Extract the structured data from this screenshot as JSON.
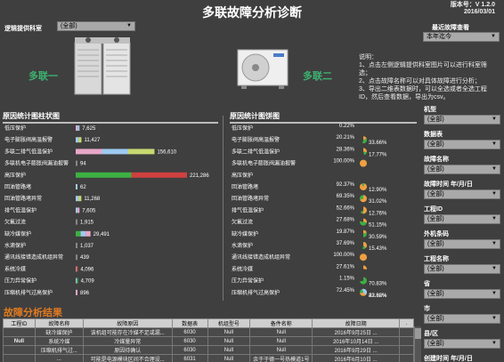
{
  "header": {
    "title": "多联故障分析诊断",
    "version": "版本号：V 1.2.0",
    "date": "2016/03/01"
  },
  "left_filter": {
    "label": "逻辑提供科室",
    "value": "(全部)"
  },
  "units": {
    "unit1": "多联一",
    "unit2": "多联二"
  },
  "instructions": {
    "heading": "说明：",
    "lines": [
      "1、点击左侧逻辑提供科室图片可以进行科室筛选；",
      "2、点击故障名称可以对具体故障进行分析；",
      "3、导出二维表数据时，可以全选或者全选工程ID，然后查看数据，导出为csv。"
    ]
  },
  "latest_fault": {
    "label": "最近故障查看",
    "value": "本年迄今"
  },
  "bar_chart_title": "原因统计图柱状图",
  "pie_chart_title": "原因统计图饼图",
  "chart_data": {
    "type": "bar",
    "orientation": "horizontal",
    "categories": [
      "低压保护",
      "电子膨胀阀高温报警",
      "多联二排气低温保护",
      "多联机电子膨胀阀漏油报警",
      "高压保护",
      "回油管路堵",
      "回油管路堵异常",
      "排气低温保护",
      "欠氟过流",
      "缺冷媒保护",
      "水滴保护",
      "通讯线接错造成机组异常",
      "系统冷媒",
      "压力异常保护",
      "压缩机排气过高保护"
    ],
    "values": [
      7625,
      11427,
      156610,
      94,
      221286,
      62,
      11268,
      7605,
      1915,
      29491,
      1037,
      439,
      4096,
      4709,
      896
    ],
    "labels": [
      "7,625",
      "11,427",
      "156,610",
      "94",
      "221,286",
      "62",
      "11,268",
      "7,605",
      "1,915",
      "29,491",
      "1,037",
      "439",
      "4,096",
      "4,709",
      "896"
    ],
    "xlim": [
      0,
      221286
    ],
    "pies": [
      {
        "category": "低压保护",
        "values": [
          0.22
        ],
        "labels": [
          "0.22%"
        ]
      },
      {
        "category": "电子膨胀阀高温报警",
        "values": [
          20.21,
          33.66
        ],
        "labels": [
          "20.21%",
          "33.66%"
        ]
      },
      {
        "category": "多联二排气低温保护",
        "values": [
          28.36,
          17.77
        ],
        "labels": [
          "28.36%",
          "17.77%"
        ]
      },
      {
        "category": "多联机电子膨胀阀漏油报警",
        "values": [
          100.0
        ],
        "labels": [
          "100.00%"
        ]
      },
      {
        "category": "高压保护",
        "values": [],
        "labels": []
      },
      {
        "category": "回油管路堵",
        "values": [
          92.37,
          12.9
        ],
        "labels": [
          "92.37%",
          "12.90%"
        ]
      },
      {
        "category": "回油管路堵异常",
        "values": [
          69.35,
          31.02
        ],
        "labels": [
          "69.35%",
          "31.02%"
        ]
      },
      {
        "category": "排气低温保护",
        "values": [
          52.66,
          12.76
        ],
        "labels": [
          "52.66%",
          "12.76%"
        ]
      },
      {
        "category": "欠氟过流",
        "values": [
          27.68,
          51.15
        ],
        "labels": [
          "27.68%",
          "51.15%"
        ]
      },
      {
        "category": "缺冷媒保护",
        "values": [
          19.87,
          30.59
        ],
        "labels": [
          "19.87%",
          "30.59%"
        ]
      },
      {
        "category": "水滴保护",
        "values": [
          37.69,
          15.43
        ],
        "labels": [
          "37.69%",
          "15.43%"
        ]
      },
      {
        "category": "通讯线接错造成机组异常",
        "values": [
          100.0
        ],
        "labels": [
          "100.00%"
        ]
      },
      {
        "category": "系统冷媒",
        "values": [
          27.61
        ],
        "labels": [
          "27.61%"
        ]
      },
      {
        "category": "压力异常保护",
        "values": [
          1.15,
          70.83
        ],
        "labels": [
          "1.15%",
          "70.83%"
        ]
      },
      {
        "category": "压缩机排气过高保护",
        "values": [
          72.45,
          22.32,
          43.68
        ],
        "labels": [
          "72.45%",
          "22.32%",
          "43.68%"
        ]
      }
    ]
  },
  "bar_segments": [
    [
      "#e8a8c8",
      "#9ec9f0"
    ],
    [
      "#9ec9f0",
      "#c8d870"
    ],
    [
      "#e8a8c8",
      "#9ec9f0",
      "#c8d870"
    ],
    [
      "#888888"
    ],
    [
      "#3cb043",
      "#d04040"
    ],
    [
      "#9ec9f0"
    ],
    [
      "#9ec9f0",
      "#c8d870"
    ],
    [
      "#9ec9f0",
      "#e8a8c8"
    ],
    [
      "#888888"
    ],
    [
      "#3cb043",
      "#9ec9f0",
      "#e8a8c8"
    ],
    [
      "#888888"
    ],
    [
      "#888888"
    ],
    [
      "#e08080",
      "#c06060"
    ],
    [
      "#9ec9f0",
      "#3cb043"
    ],
    [
      "#e8a8c8"
    ]
  ],
  "pie_colors": [
    "#f0a040",
    "#3cb043",
    "#9ec9f0",
    "#e8a8c8"
  ],
  "results": {
    "title": "故障分析结果",
    "columns": [
      "工程ID",
      "故障名称",
      "故障原因",
      "数据表",
      "机组型号",
      "备件名称",
      "故障日期",
      "."
    ],
    "rows": [
      [
        "",
        "缺冷媒保护",
        "该机组可能存在冷媒不足或漏...",
        "6030",
        "Null",
        "Null",
        "2016年9月25日 ...",
        ""
      ],
      [
        "Null",
        "系统冷媒",
        "冷媒量异常",
        "6030",
        "Null",
        "Null",
        "2016年10月14日 ...",
        ""
      ],
      [
        "",
        "压缩机排气过...",
        "原因待确认",
        "6030",
        "Null",
        "Null",
        "2016年9月29日 ...",
        ""
      ],
      [
        "",
        "...",
        "可能是电源模块区间不合理设...",
        "6031",
        "Null",
        "余于于德一号热模道1号",
        "2016年6月10日 ...",
        ""
      ]
    ]
  },
  "right_filters": [
    {
      "label": "机型",
      "value": "(全部)"
    },
    {
      "label": "数据表",
      "value": "(全部)"
    },
    {
      "label": "故障名称",
      "value": "(全部)"
    },
    {
      "label": "故障时间 年/月/日",
      "value": "(全部)"
    },
    {
      "label": "工程ID",
      "value": "(全部)"
    },
    {
      "label": "外机条码",
      "value": "(全部)"
    },
    {
      "label": "工程名称",
      "value": "(全部)"
    },
    {
      "label": "省",
      "value": "(全部)"
    },
    {
      "label": "市",
      "value": "(全部)"
    },
    {
      "label": "县/区",
      "value": "(全部)"
    },
    {
      "label": "创建时间 年/月/日",
      "value": "(全部)"
    }
  ]
}
